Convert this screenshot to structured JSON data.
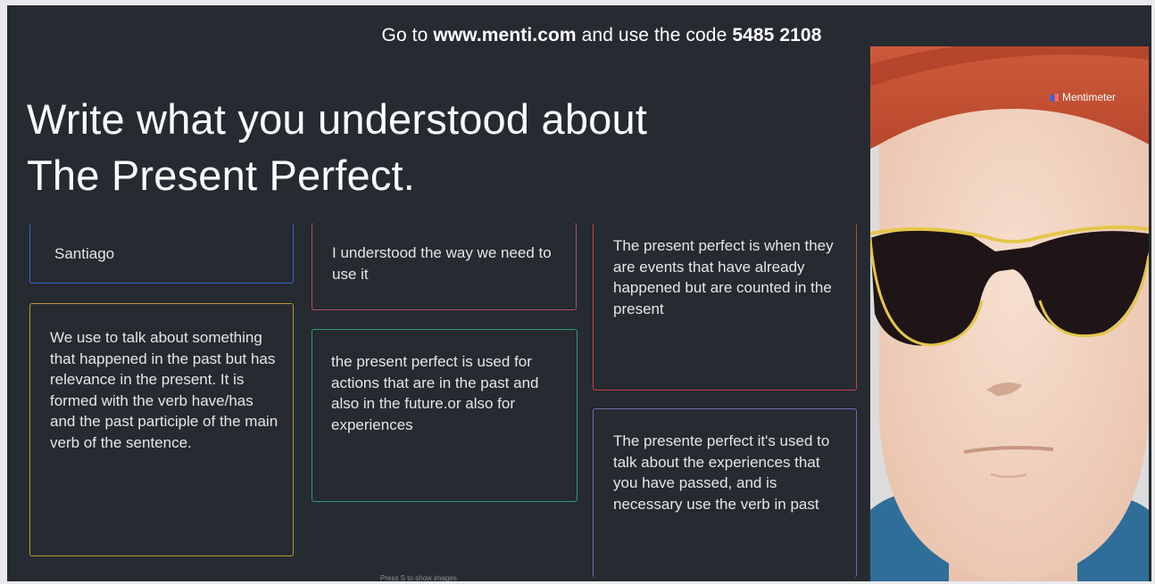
{
  "header": {
    "prefix": "Go to ",
    "url": "www.menti.com",
    "middle": " and use the code ",
    "code": "5485 2108"
  },
  "question": "Write what you understood about The Present Perfect.",
  "responses": [
    {
      "text": "Santiago",
      "color": "#3b65c9"
    },
    {
      "text": "We use to talk about something that happened in the past but has relevance in the present. It is formed with the verb have/has and the past participle of the main verb of the sentence.",
      "color": "#b8962f"
    },
    {
      "text": "I understood the way we need to use it",
      "color": "#b44f67"
    },
    {
      "text": "the present perfect is used for actions that are in the past and also in the future.or also for experiences",
      "color": "#2e9a76"
    },
    {
      "text": "The present perfect is when they are events that have already happened but are counted in the present",
      "color": "#c54340"
    },
    {
      "text": "The presente perfect it's used to talk about the experiences that you have passed, and is necessary use the verb in past",
      "color": "#6a6fb0"
    }
  ],
  "brand": {
    "name": "Mentimeter"
  },
  "footer_hint": "Press S to show images",
  "colors": {
    "background": "#262a31",
    "text": "#ffffff"
  },
  "avatar": {
    "icon": "avatar-with-sunglasses"
  }
}
